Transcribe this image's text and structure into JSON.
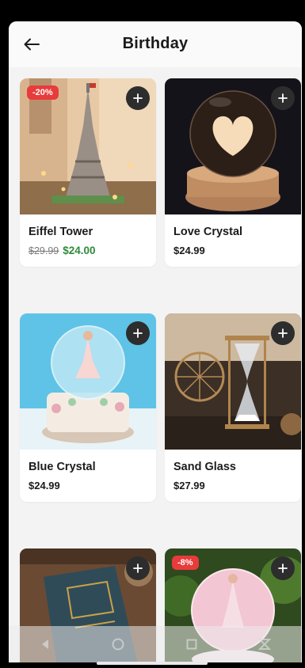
{
  "header": {
    "title": "Birthday",
    "back_icon": "arrow-left-icon"
  },
  "products": [
    {
      "name": "Eiffel Tower",
      "old_price": "$29.99",
      "price": "$24.00",
      "discount": "-20%"
    },
    {
      "name": "Love Crystal",
      "price": "$24.99"
    },
    {
      "name": "Blue Crystal",
      "price": "$24.99"
    },
    {
      "name": "Sand Glass",
      "price": "$27.99"
    },
    {
      "name": "",
      "price": ""
    },
    {
      "name": "",
      "price": "",
      "discount": "-8%"
    }
  ],
  "add_icon": "plus-icon",
  "colors": {
    "sale": "#2e8b3a",
    "badge": "#e83b3b",
    "add_button": "#2d2d2d"
  }
}
